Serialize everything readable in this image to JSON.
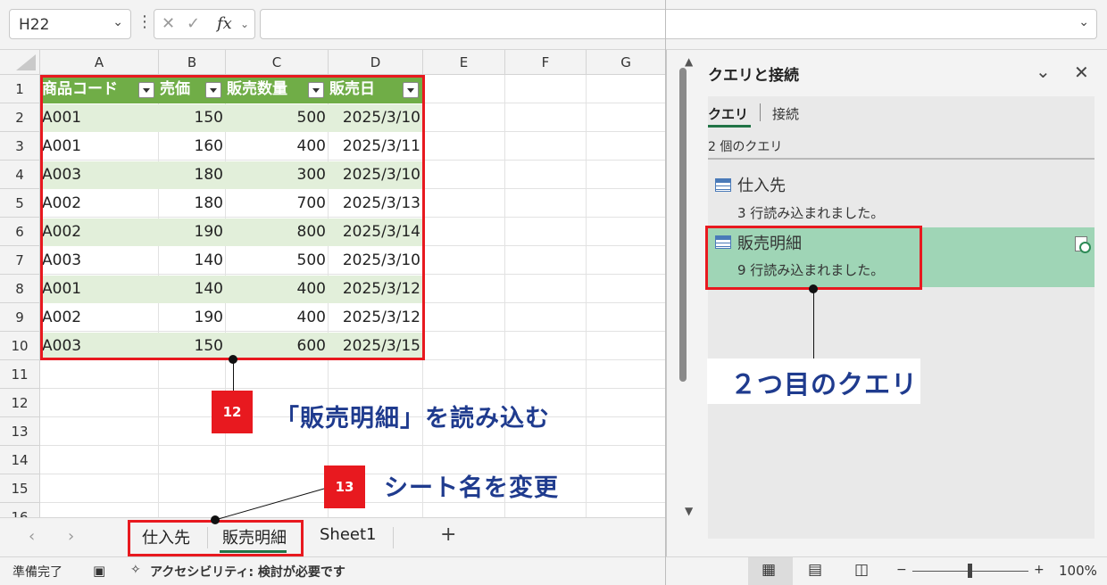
{
  "formula_bar": {
    "name_box": "H22",
    "fx_label": "fx",
    "cancel_glyph": "✕",
    "enter_glyph": "✓",
    "formula": ""
  },
  "grid": {
    "columns": [
      "A",
      "B",
      "C",
      "D",
      "E",
      "F",
      "G"
    ],
    "rows": [
      "1",
      "2",
      "3",
      "4",
      "5",
      "6",
      "7",
      "8",
      "9",
      "10",
      "11",
      "12",
      "13",
      "14",
      "15",
      "16"
    ],
    "table_headers": [
      "商品コード",
      "売価",
      "販売数量",
      "販売日"
    ],
    "table_rows": [
      [
        "A001",
        "150",
        "500",
        "2025/3/10"
      ],
      [
        "A001",
        "160",
        "400",
        "2025/3/11"
      ],
      [
        "A003",
        "180",
        "300",
        "2025/3/10"
      ],
      [
        "A002",
        "180",
        "700",
        "2025/3/13"
      ],
      [
        "A002",
        "190",
        "800",
        "2025/3/14"
      ],
      [
        "A003",
        "140",
        "500",
        "2025/3/10"
      ],
      [
        "A001",
        "140",
        "400",
        "2025/3/12"
      ],
      [
        "A002",
        "190",
        "400",
        "2025/3/12"
      ],
      [
        "A003",
        "150",
        "600",
        "2025/3/15"
      ]
    ]
  },
  "sheet_tabs": {
    "tabs": [
      "仕入先",
      "販売明細",
      "Sheet1"
    ],
    "active": "販売明細",
    "add_label": "+",
    "prev_glyph": "‹",
    "next_glyph": "›"
  },
  "status_bar": {
    "ready": "準備完了",
    "accessibility": "アクセシビリティ: 検討が必要です",
    "zoom": "100%",
    "zoom_minus": "−",
    "zoom_plus": "+"
  },
  "pane": {
    "title": "クエリと接続",
    "tabs": [
      "クエリ",
      "接続"
    ],
    "count": "2 個のクエリ",
    "queries": [
      {
        "name": "仕入先",
        "status": "3 行読み込まれました。"
      },
      {
        "name": "販売明細",
        "status": "9 行読み込まれました。"
      }
    ]
  },
  "annotations": {
    "badge12": "12",
    "text12": "「販売明細」を読み込む",
    "badge13": "13",
    "text13": "シート名を変更",
    "pane_callout": "２つ目のクエリ"
  },
  "colors": {
    "table_header": "#70ad47",
    "table_band": "#e2efda",
    "selected_query": "#9fd5b6",
    "annotation_red": "#e8191f",
    "callout_text": "#1f3b8e",
    "excel_green": "#217346"
  }
}
